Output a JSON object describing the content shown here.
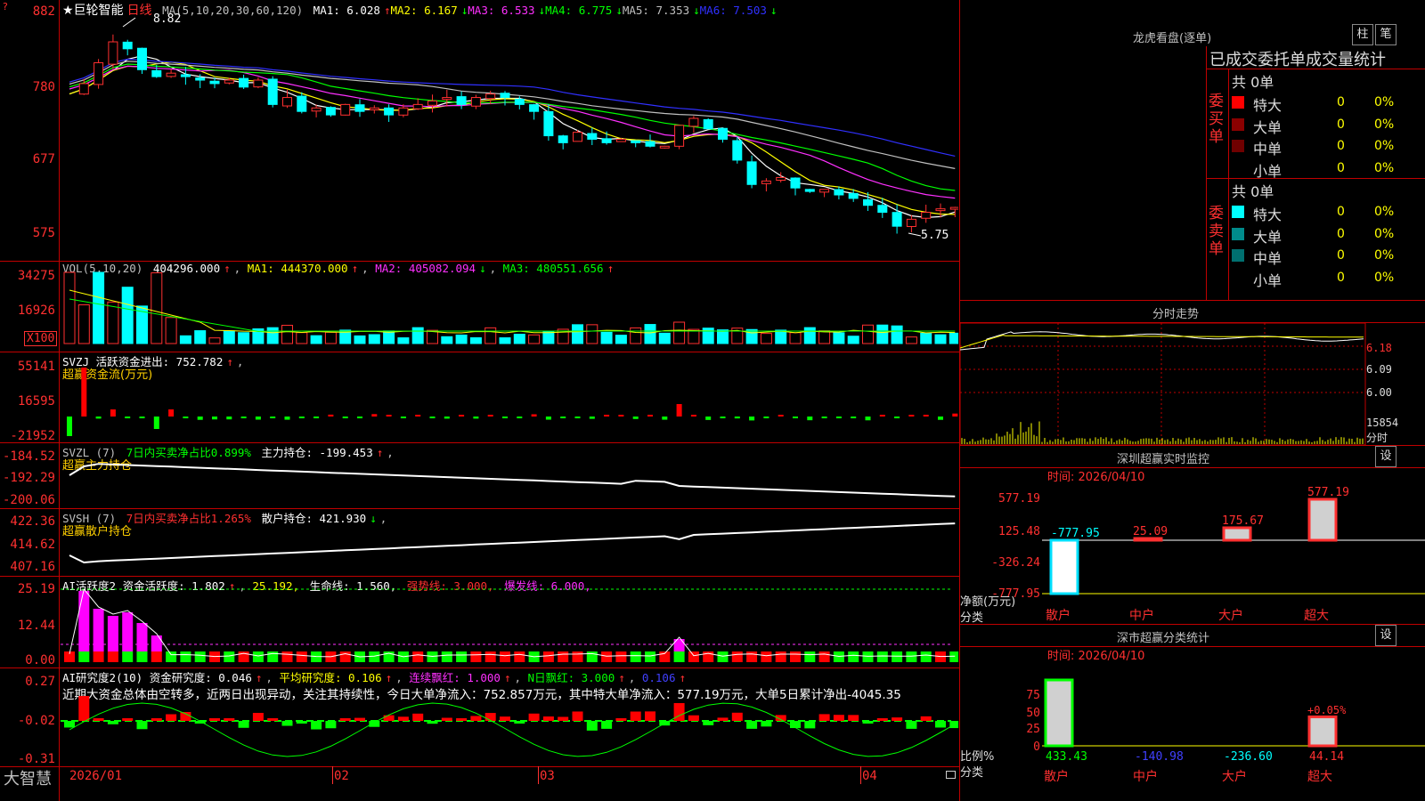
{
  "stock": {
    "star_name": "★巨轮智能",
    "period": "日线"
  },
  "main": {
    "title": "MA(5,10,20,30,60,120)",
    "ma": [
      {
        "label": "MA1: 6.028",
        "arrow": "↑",
        "color": "#ffffff"
      },
      {
        "label": "MA2: 6.167",
        "arrow": "↓",
        "color": "#ffff00"
      },
      {
        "label": "MA3: 6.533",
        "arrow": "↓",
        "color": "#ff30ff"
      },
      {
        "label": "MA4: 6.775",
        "arrow": "↓",
        "color": "#00ff00"
      },
      {
        "label": "MA5: 7.353",
        "arrow": "↓",
        "color": "#c0c0c0"
      },
      {
        "label": "MA6: 7.503",
        "arrow": "↓",
        "color": "#3030ff"
      }
    ],
    "yaxis": [
      "882",
      "780",
      "677",
      "575"
    ],
    "high_label": "8.82",
    "low_label": "5.75"
  },
  "vol": {
    "title": "VOL(5,10,20)",
    "value": "404296.000",
    "ma1": "MA1: 444370.000",
    "ma2": "MA2: 405082.094",
    "ma3": "MA3: 480551.656",
    "yaxis": [
      "34275",
      "16926"
    ],
    "unit": "X100"
  },
  "svzj": {
    "title": "SVZJ  活跃资金进出: 752.782",
    "sub": "超赢资金流(万元)",
    "yaxis": [
      "55141",
      "16595",
      "-21952"
    ]
  },
  "svzl": {
    "title": "SVZL (7)",
    "t1": "7日内买卖净占比0.899%",
    "t2": "主力持仓: -199.453",
    "sub": "超赢主力持仓",
    "yaxis": [
      "-184.52",
      "-192.29",
      "-200.06"
    ]
  },
  "svsh": {
    "title": "SVSH (7)",
    "t1": "7日内买卖净占比1.265%",
    "t2": "散户持仓: 421.930",
    "sub": "超赢散户持仓",
    "yaxis": [
      "422.36",
      "414.62",
      "407.16"
    ]
  },
  "ai1": {
    "title": "AI活跃度2 资金活跃度: 1.802",
    "t1": "25.192,",
    "t2": "生命线: 1.560,",
    "t3": "强势线: 3.000,",
    "t4": "爆发线: 6.000,",
    "yaxis": [
      "25.19",
      "12.44",
      "0.00"
    ]
  },
  "ai2": {
    "title": "AI研究度2(10) 资金研究度: 0.046",
    "t1": "平均研究度: 0.106",
    "t2": "连续飘红: 1.000",
    "t3": "N日飘红: 3.000",
    "t4": "0.106",
    "commentary": "近期大资金总体由空转多，近两日出现异动，关注其持续性，今日大单净流入：752.857万元，其中特大单净流入：577.19万元，大单5日累计净出-4045.35",
    "yaxis": [
      "0.27",
      "-0.02",
      "-0.31"
    ]
  },
  "xaxis": [
    "2026/01",
    "02",
    "03",
    "04"
  ],
  "brand": "大智慧",
  "right": {
    "dragon": {
      "title": "龙虎看盘(逐单)",
      "btn1": "柱",
      "btn2": "笔",
      "header": "已成交委托单成交量统计",
      "buy_label": "委买单",
      "sell_label": "委卖单",
      "buy_total": "共 0单",
      "sell_total": "共 0单",
      "buy_rows": [
        {
          "name": "特大",
          "n": "0",
          "pct": "0%",
          "color": "#ff0000"
        },
        {
          "name": "大单",
          "n": "0",
          "pct": "0%",
          "color": "#8b0000"
        },
        {
          "name": "中单",
          "n": "0",
          "pct": "0%",
          "color": "#700000"
        },
        {
          "name": "小单",
          "n": "0",
          "pct": "0%",
          "color": "#000000"
        }
      ],
      "sell_rows": [
        {
          "name": "特大",
          "n": "0",
          "pct": "0%",
          "color": "#00ffff"
        },
        {
          "name": "大单",
          "n": "0",
          "pct": "0%",
          "color": "#008b8b"
        },
        {
          "name": "中单",
          "n": "0",
          "pct": "0%",
          "color": "#007070"
        },
        {
          "name": "小单",
          "n": "0",
          "pct": "0%",
          "color": "#000000"
        }
      ]
    },
    "minute": {
      "title": "分时走势",
      "yaxis": [
        "6.18",
        "6.09",
        "6.00"
      ],
      "vol_label": "15854",
      "time_label": "分时"
    },
    "monitor": {
      "title": "深圳超赢实时监控",
      "btn": "设",
      "time": "时间: 2026/04/10",
      "yaxis": [
        "577.19",
        "125.48",
        "-326.24",
        "-777.95"
      ],
      "net_label": "净额(万元)",
      "cat_label": "分类",
      "bars": [
        {
          "label": "散户",
          "value": "-777.95",
          "num": -777.95
        },
        {
          "label": "中户",
          "value": "25.09",
          "num": 25.09
        },
        {
          "label": "大户",
          "value": "175.67",
          "num": 175.67
        },
        {
          "label": "超大",
          "value": "577.19",
          "num": 577.19
        }
      ]
    },
    "classify": {
      "title": "深市超赢分类统计",
      "btn": "设",
      "time": "时间: 2026/04/10",
      "yaxis": [
        "75",
        "50",
        "25",
        "0"
      ],
      "pct_label": "比例%",
      "cat_label": "分类",
      "annot": "+0.05%",
      "cats": [
        {
          "label": "散户",
          "value": "433.43",
          "pct": 100
        },
        {
          "label": "中户",
          "value": "-140.98",
          "pct": 0
        },
        {
          "label": "大户",
          "value": "-236.60",
          "pct": 0
        },
        {
          "label": "超大",
          "value": "44.14",
          "pct": 44
        }
      ]
    }
  }
}
